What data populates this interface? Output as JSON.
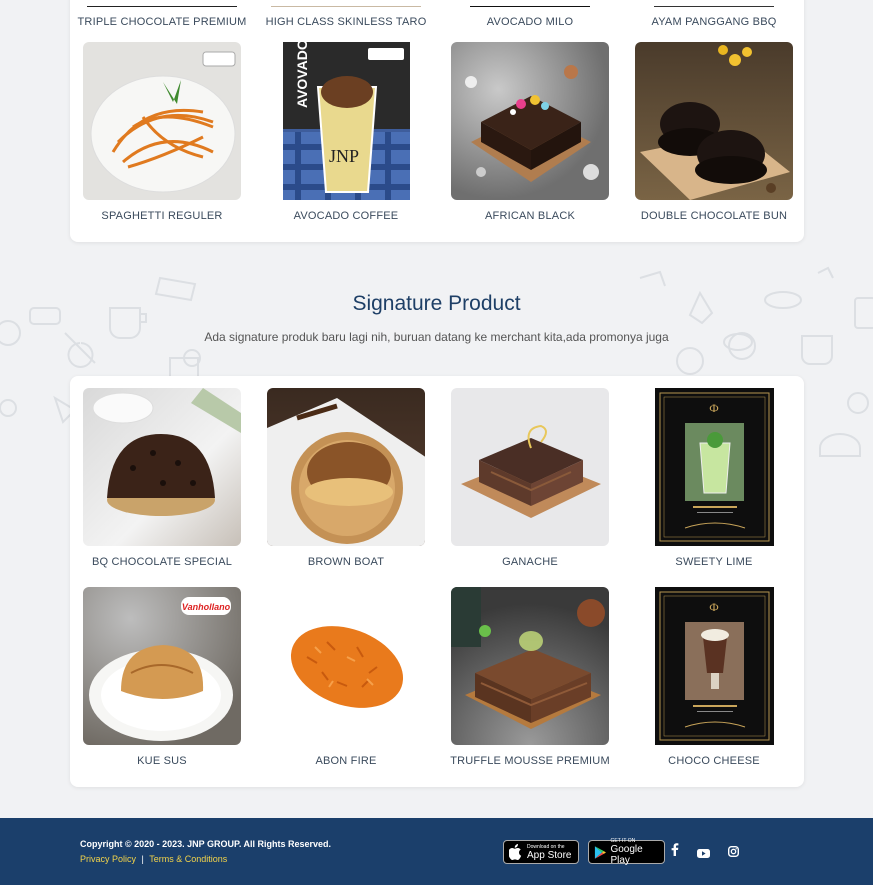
{
  "top_products": [
    {
      "name": "TRIPLE CHOCOLATE PREMIUM"
    },
    {
      "name": "HIGH CLASS SKINLESS TARO"
    },
    {
      "name": "AVOCADO MILO"
    },
    {
      "name": "AYAM PANGGANG BBQ"
    }
  ],
  "products_row2": [
    {
      "name": "SPAGHETTI REGULER",
      "image": "spaghetti-photo"
    },
    {
      "name": "AVOCADO COFFEE",
      "image": "avocado-coffee-photo",
      "overlay_text": "AVOVADO"
    },
    {
      "name": "AFRICAN BLACK",
      "image": "african-black-cake-photo"
    },
    {
      "name": "DOUBLE CHOCOLATE BUN",
      "image": "double-chocolate-bun-photo"
    }
  ],
  "signature": {
    "title": "Signature Product",
    "subtitle": "Ada signature produk baru lagi nih, buruan datang ke merchant kita,ada promonya juga",
    "products": [
      {
        "name": "BQ CHOCOLATE SPECIAL",
        "image": "bq-chocolate-special-photo"
      },
      {
        "name": "BROWN BOAT",
        "image": "brown-boat-photo"
      },
      {
        "name": "GANACHE",
        "image": "ganache-cake-photo"
      },
      {
        "name": "SWEETY LIME",
        "image": "sweety-lime-poster"
      },
      {
        "name": "KUE SUS",
        "image": "kue-sus-photo",
        "badge": "Vanhollano"
      },
      {
        "name": "ABON FIRE",
        "image": "abon-fire-photo"
      },
      {
        "name": "TRUFFLE MOUSSE PREMIUM",
        "image": "truffle-mousse-photo"
      },
      {
        "name": "CHOCO CHEESE",
        "image": "choco-cheese-poster"
      }
    ]
  },
  "footer": {
    "copyright": "Copyright © 2020 - 2023. JNP GROUP. All Rights Reserved.",
    "privacy": "Privacy Policy",
    "separator": "|",
    "terms": "Terms & Conditions",
    "app_store_small": "Download on the",
    "app_store_big": "App Store",
    "play_small": "GET IT ON",
    "play_big": "Google Play",
    "social_icons": [
      "facebook-icon",
      "youtube-icon",
      "instagram-icon"
    ]
  },
  "colors": {
    "footer_bg": "#1b3f6b",
    "title": "#1e3f66",
    "link": "#f3d44a"
  }
}
